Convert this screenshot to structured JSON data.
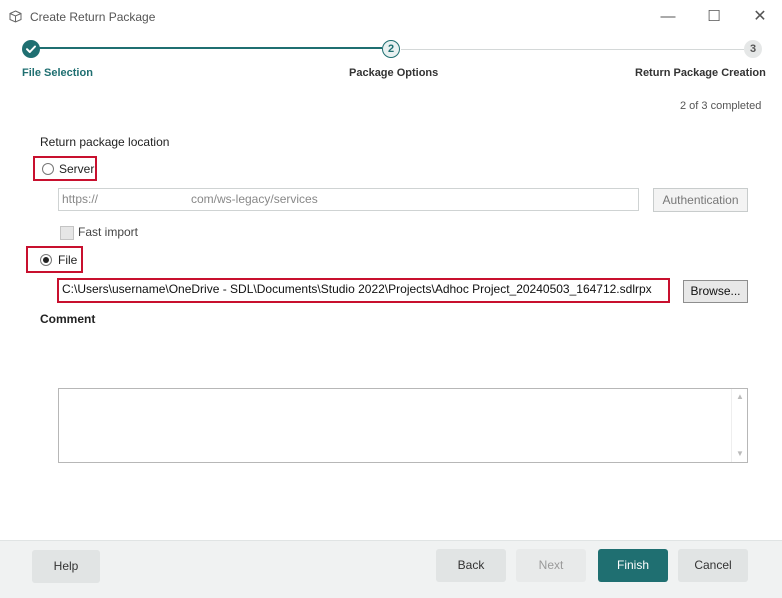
{
  "window": {
    "title": "Create Return Package",
    "icons": {
      "app": "package-icon",
      "minimize": "minimize-icon",
      "maximize": "maximize-icon",
      "close": "close-icon"
    },
    "min_glyph": "—",
    "max_glyph": "☐",
    "close_glyph": "✕"
  },
  "stepper": {
    "steps": [
      {
        "label": "File Selection",
        "state": "completed",
        "icon": "check-icon"
      },
      {
        "label": "Package Options",
        "number": "2",
        "state": "current"
      },
      {
        "label": "Return Package Creation",
        "number": "3",
        "state": "pending"
      }
    ],
    "progress_text": "2 of 3 completed",
    "colors": {
      "accent": "#1f6f71",
      "pending": "#e5e7e7"
    }
  },
  "form": {
    "location_label": "Return package location",
    "server": {
      "label": "Server",
      "selected": false,
      "url_prefix": "https://",
      "url_suffix": "com/ws-legacy/services",
      "auth_button": "Authentication",
      "fast_import_label": "Fast import",
      "fast_import_checked": false
    },
    "file": {
      "label": "File",
      "selected": true,
      "path": "C:\\Users\\username\\OneDrive - SDL\\Documents\\Studio 2022\\Projects\\Adhoc Project_20240503_164712.sdlrpx",
      "browse_button": "Browse..."
    },
    "comment": {
      "label": "Comment",
      "value": ""
    },
    "highlight_color": "#c8102e"
  },
  "footer": {
    "help": "Help",
    "back": "Back",
    "next": "Next",
    "finish": "Finish",
    "cancel": "Cancel"
  }
}
